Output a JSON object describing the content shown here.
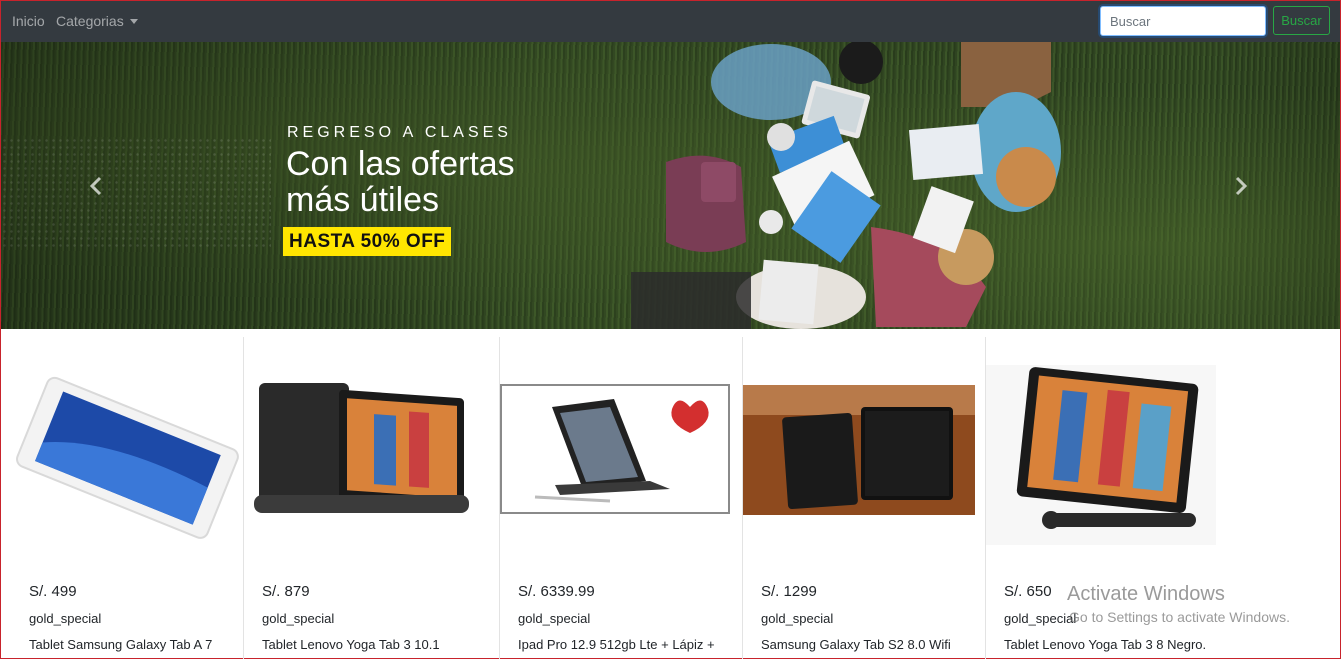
{
  "navbar": {
    "home_label": "Inicio",
    "categories_label": "Categorias",
    "search_placeholder": "Buscar",
    "search_button": "Buscar"
  },
  "banner": {
    "kicker": "REGRESO A CLASES",
    "title": "Con las ofertas más útiles",
    "tag": "HASTA 50% OFF",
    "tag_color": "#ffe600"
  },
  "products": [
    {
      "price": "S/. 499",
      "brand": "gold_special",
      "name": "Tablet Samsung Galaxy Tab A 7",
      "image": "white-tablet-image"
    },
    {
      "price": "S/. 879",
      "brand": "gold_special",
      "name": "Tablet Lenovo Yoga Tab 3 10.1",
      "image": "lenovo-yoga-stand-image"
    },
    {
      "price": "S/. 6339.99",
      "brand": "gold_special",
      "name": "Ipad Pro 12.9 512gb Lte + Lápiz +",
      "image": "ipad-keyboard-image"
    },
    {
      "price": "S/. 1299",
      "brand": "gold_special",
      "name": "Samsung Galaxy Tab S2 8.0 Wifi",
      "image": "two-tablets-photo"
    },
    {
      "price": "S/. 650",
      "brand": "gold_special",
      "name": "Tablet Lenovo Yoga Tab 3 8 Negro.",
      "image": "lenovo-yoga-image"
    }
  ],
  "watermark": {
    "title": "Activate Windows",
    "subtitle": "Go to Settings to activate Windows."
  },
  "colors": {
    "navbar_bg": "#343a40",
    "success": "#28a745",
    "frame_border": "#c8232c"
  }
}
